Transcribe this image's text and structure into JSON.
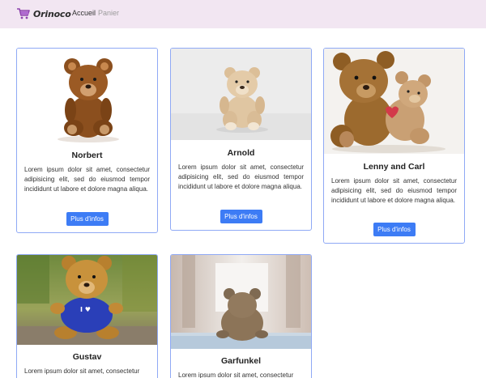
{
  "navbar": {
    "brand": "Orinoco",
    "links": [
      "Accueil",
      "Panier"
    ]
  },
  "products": [
    {
      "name": "Norbert",
      "description": "Lorem ipsum dolor sit amet, consectetur adipisicing elit, sed do eiusmod tempor incididunt ut labore et dolore magna aliqua.",
      "button": "Plus d'infos",
      "image": "brown-teddy-bear-sitting"
    },
    {
      "name": "Arnold",
      "description": "Lorem ipsum dolor sit amet, consectetur adipisicing elit, sed do eiusmod tempor incididunt ut labore et dolore magna aliqua.",
      "button": "Plus d'infos",
      "image": "beige-teddy-bear-grey-background"
    },
    {
      "name": "Lenny and Carl",
      "description": "Lorem ipsum dolor sit amet, consectetur adipisicing elit, sed do eiusmod tempor incididunt ut labore et dolore magna aliqua.",
      "button": "Plus d'infos",
      "image": "two-teddy-bears-hugging"
    },
    {
      "name": "Gustav",
      "description": "Lorem ipsum dolor sit amet, consectetur",
      "button": "",
      "image": "teddy-bear-blue-shirt-outdoors",
      "shirt_text": "I ♥"
    },
    {
      "name": "Garfunkel",
      "description": "Lorem ipsum dolor sit amet, consectetur",
      "button": "",
      "image": "teddy-bear-back-view-window"
    }
  ],
  "colors": {
    "navbar_bg": "#f2e6f2",
    "card_border": "#8fa9f5",
    "button_bg": "#3d7cf5",
    "cart_icon": "#8e44ad"
  }
}
